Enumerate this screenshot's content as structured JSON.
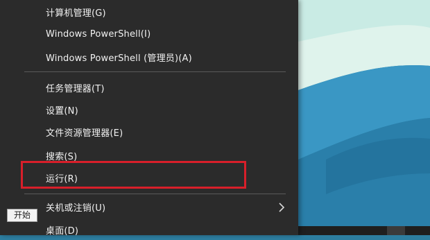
{
  "menu": {
    "items": [
      {
        "label": "计算机管理(G)"
      },
      {
        "label": "Windows PowerShell(I)"
      },
      {
        "label": "Windows PowerShell (管理员)(A)"
      },
      {
        "label": "任务管理器(T)"
      },
      {
        "label": "设置(N)"
      },
      {
        "label": "文件资源管理器(E)"
      },
      {
        "label": "搜索(S)"
      },
      {
        "label": "运行(R)"
      },
      {
        "label": "关机或注销(U)"
      },
      {
        "label": "桌面(D)"
      }
    ]
  },
  "tooltip": {
    "text": "开始"
  },
  "colors": {
    "menu_bg": "#2b2b2b",
    "menu_text": "#f2f2f2",
    "highlight_border": "#d81f2a",
    "wallpaper_sky": "#dff3ec",
    "wallpaper_water": "#2d86b0"
  },
  "icons": {
    "submenu_arrow": "chevron-right-icon"
  }
}
